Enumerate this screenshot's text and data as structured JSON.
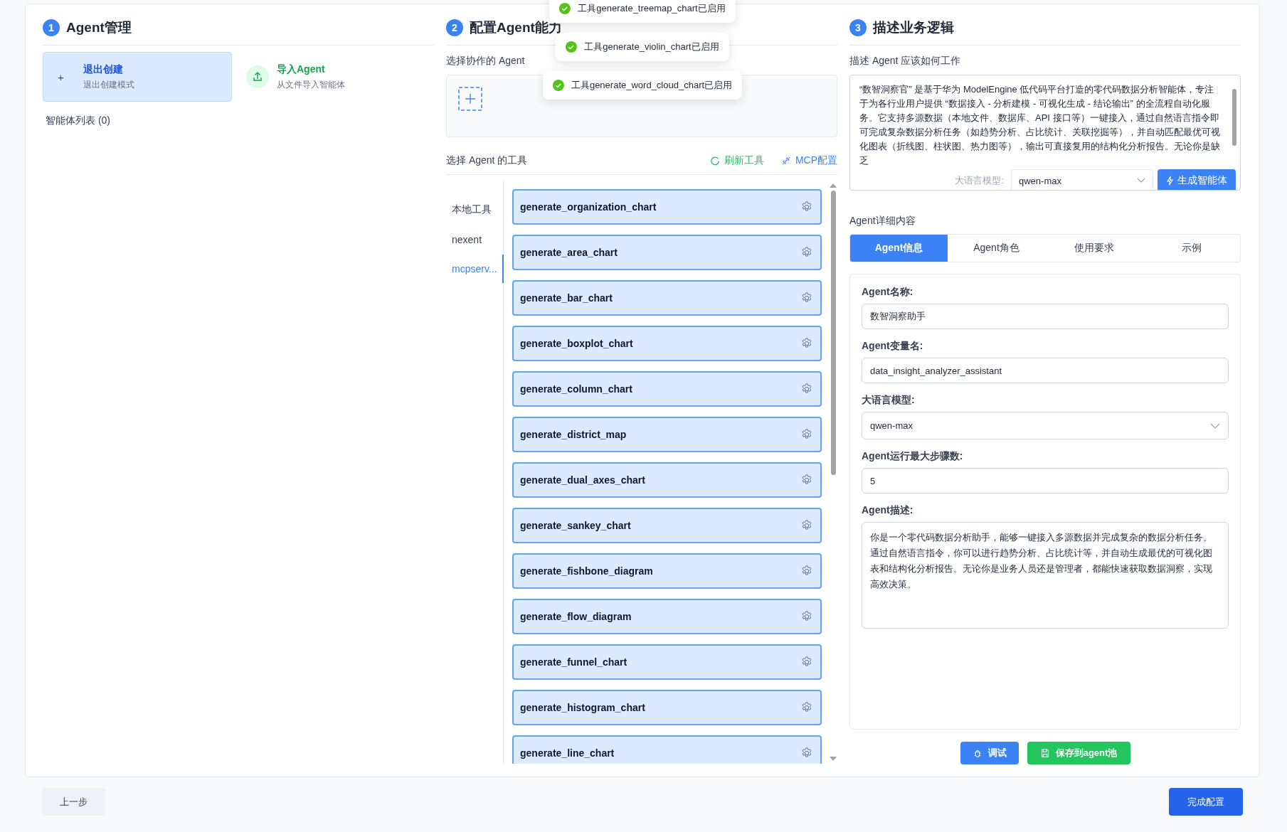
{
  "agent_management": {
    "step": "1",
    "title": "Agent管理",
    "exit_create": {
      "icon": "+",
      "title": "退出创建",
      "subtitle": "退出创建模式"
    },
    "import": {
      "title": "导入Agent",
      "subtitle": "从文件导入智能体"
    },
    "list_label": "智能体列表 (0)"
  },
  "capabilities": {
    "step": "2",
    "title": "配置Agent能力",
    "collab_label": "选择协作的 Agent",
    "tools_label": "选择 Agent 的工具",
    "refresh": "刷新工具",
    "mcp": "MCP配置",
    "categories": [
      {
        "label": "本地工具",
        "selected": false
      },
      {
        "label": "nexent",
        "selected": false
      },
      {
        "label": "mcpserv...",
        "selected": true
      }
    ],
    "tools": [
      {
        "name": "generate_organization_chart",
        "selected": true
      },
      {
        "name": "generate_area_chart",
        "selected": true
      },
      {
        "name": "generate_bar_chart",
        "selected": true
      },
      {
        "name": "generate_boxplot_chart",
        "selected": true
      },
      {
        "name": "generate_column_chart",
        "selected": true
      },
      {
        "name": "generate_district_map",
        "selected": true
      },
      {
        "name": "generate_dual_axes_chart",
        "selected": true
      },
      {
        "name": "generate_sankey_chart",
        "selected": true
      },
      {
        "name": "generate_fishbone_diagram",
        "selected": true
      },
      {
        "name": "generate_flow_diagram",
        "selected": true
      },
      {
        "name": "generate_funnel_chart",
        "selected": true
      },
      {
        "name": "generate_histogram_chart",
        "selected": true
      },
      {
        "name": "generate_line_chart",
        "selected": true
      }
    ]
  },
  "toasts": [
    "工具generate_treemap_chart已启用",
    "工具generate_violin_chart已启用",
    "工具generate_word_cloud_chart已启用"
  ],
  "business": {
    "step": "3",
    "title": "描述业务逻辑",
    "prompt_label": "描述 Agent 应该如何工作",
    "description": "“数智洞察官” 是基于华为 ModelEngine 低代码平台打造的零代码数据分析智能体，专注于为各行业用户提供 “数据接入 - 分析建模 - 可视化生成 - 结论输出” 的全流程自动化服务。它支持多源数据（本地文件、数据库、API 接口等）一键接入，通过自然语言指令即可完成复杂数据分析任务（如趋势分析、占比统计、关联挖掘等），并自动匹配最优可视化图表（折线图、柱状图、热力图等），输出可直接复用的结构化分析报告。无论你是缺乏",
    "overlay": {
      "model_label": "大语言模型:",
      "model": "qwen-max",
      "generate": "生成智能体"
    },
    "details_label": "Agent详细内容",
    "tabs": [
      {
        "label": "Agent信息",
        "selected": true
      },
      {
        "label": "Agent角色",
        "selected": false
      },
      {
        "label": "使用要求",
        "selected": false
      },
      {
        "label": "示例",
        "selected": false
      }
    ],
    "fields": [
      {
        "kind": "input",
        "label": "Agent名称:",
        "value": "数智洞察助手"
      },
      {
        "kind": "input",
        "label": "Agent变量名:",
        "value": "data_insight_analyzer_assistant"
      },
      {
        "kind": "select",
        "label": "大语言模型:",
        "value": "qwen-max"
      },
      {
        "kind": "input",
        "label": "Agent运行最大步骤数:",
        "value": "5"
      },
      {
        "kind": "textarea",
        "label": "Agent描述:",
        "value": "你是一个零代码数据分析助手，能够一键接入多源数据并完成复杂的数据分析任务。通过自然语言指令，你可以进行趋势分析、占比统计等，并自动生成最优的可视化图表和结构化分析报告。无论你是业务人员还是管理者，都能快速获取数据洞察，实现高效决策。"
      }
    ],
    "debug": "调试",
    "save": "保存到agent池"
  },
  "footer": {
    "back": "上一步",
    "finish": "完成配置"
  }
}
